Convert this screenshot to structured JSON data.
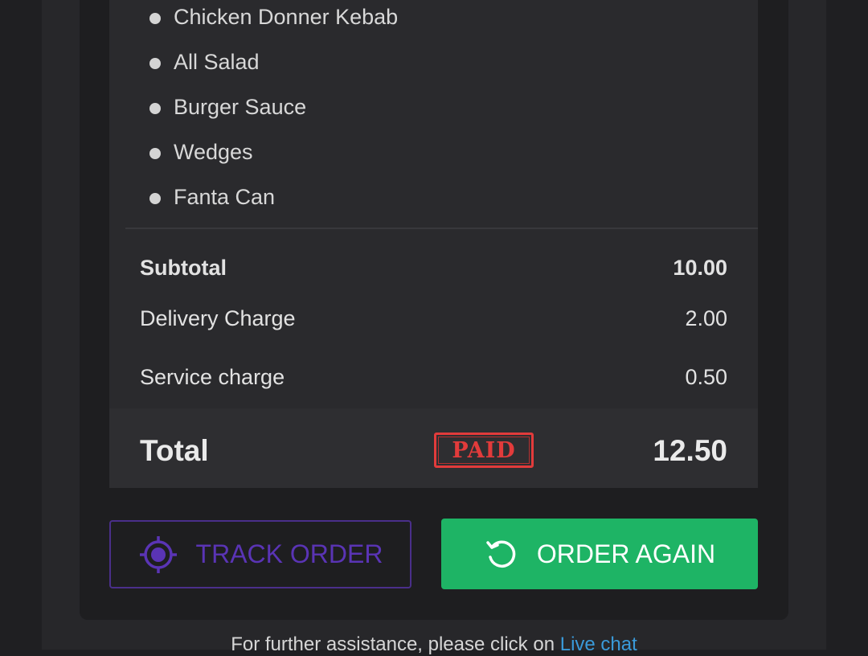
{
  "order_items": [
    "Chicken Donner Kebab",
    "All Salad",
    "Burger Sauce",
    "Wedges",
    "Fanta Can"
  ],
  "summary": {
    "subtotal_label": "Subtotal",
    "subtotal_value": "10.00",
    "delivery_label": "Delivery Charge",
    "delivery_value": "2.00",
    "service_label": "Service charge",
    "service_value": "0.50",
    "total_label": "Total",
    "total_value": "12.50",
    "paid_stamp": "PAID"
  },
  "actions": {
    "track_label": "TRACK ORDER",
    "again_label": "ORDER AGAIN"
  },
  "footer": {
    "text": "For further assistance, please click on ",
    "link": "Live chat"
  },
  "colors": {
    "accent_green": "#1eb465",
    "accent_purple": "#5a34b5",
    "stamp_red": "#e23b3b",
    "link_blue": "#3a9ad9"
  },
  "icons": {
    "track": "crosshair-target-icon",
    "again": "refresh-icon",
    "bullet": "bullet-dot-icon"
  }
}
